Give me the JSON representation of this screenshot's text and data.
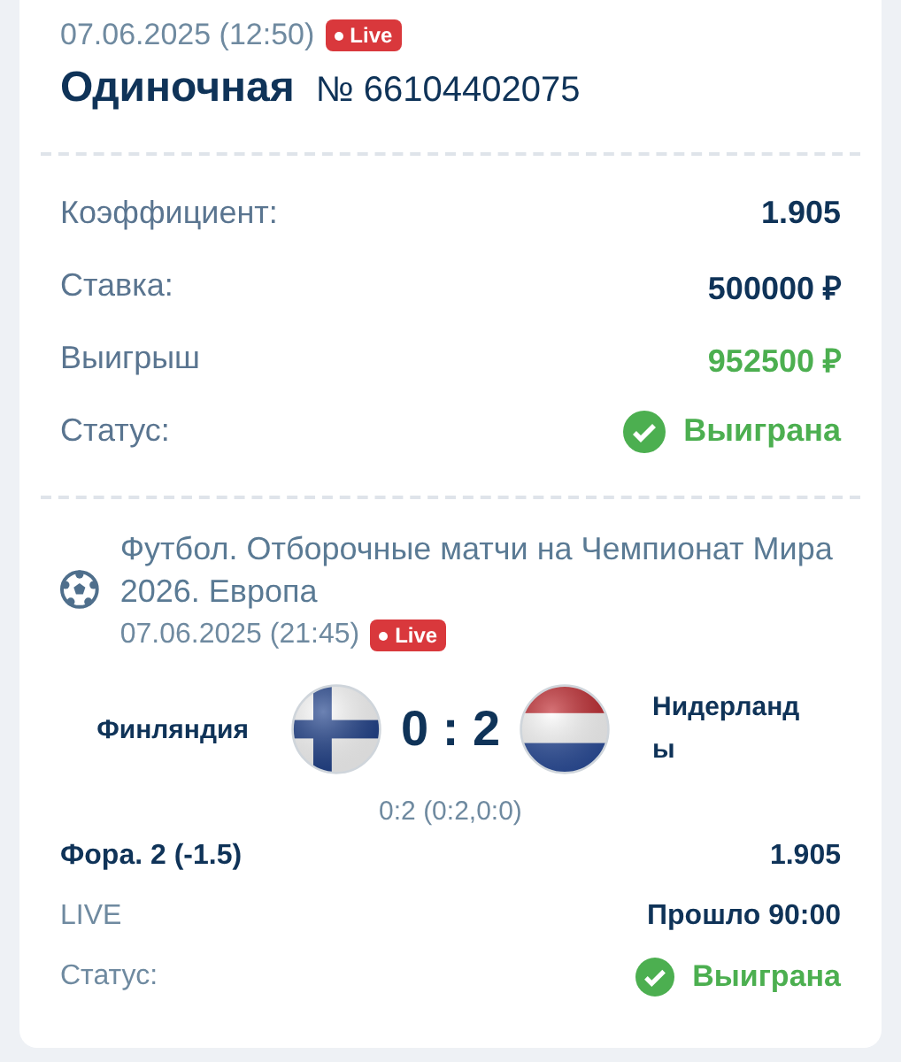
{
  "header": {
    "datetime": "07.06.2025 (12:50)",
    "live_badge": "Live",
    "bet_type": "Одиночная",
    "bet_number": "№ 66104402075"
  },
  "summary": [
    {
      "label": "Коэффициент:",
      "value": "1.905",
      "kind": "plain"
    },
    {
      "label": "Ставка:",
      "value": "500000 ₽",
      "kind": "plain"
    },
    {
      "label": "Выигрыш",
      "value": "952500 ₽",
      "kind": "win"
    },
    {
      "label": "Статус:",
      "value": "Выиграна",
      "kind": "status"
    }
  ],
  "event": {
    "tournament": "Футбол. Отборочные матчи на Чемпионат Мира 2026. Европа",
    "datetime": "07.06.2025 (21:45)",
    "live_badge": "Live",
    "home": {
      "name": "Финляндия",
      "kind": "finland"
    },
    "score": "0 : 2",
    "away": {
      "name": "Нидерланды",
      "kind": "netherlands"
    },
    "score_detail": "0:2 (0:2,0:0)",
    "rows": [
      {
        "label": "Фора. 2 (-1.5)",
        "value": "1.905",
        "kind": "plain"
      },
      {
        "label": "LIVE",
        "value": "Прошло 90:00",
        "kind": "muted"
      },
      {
        "label": "Статус:",
        "value": "Выиграна",
        "kind": "status"
      }
    ]
  }
}
